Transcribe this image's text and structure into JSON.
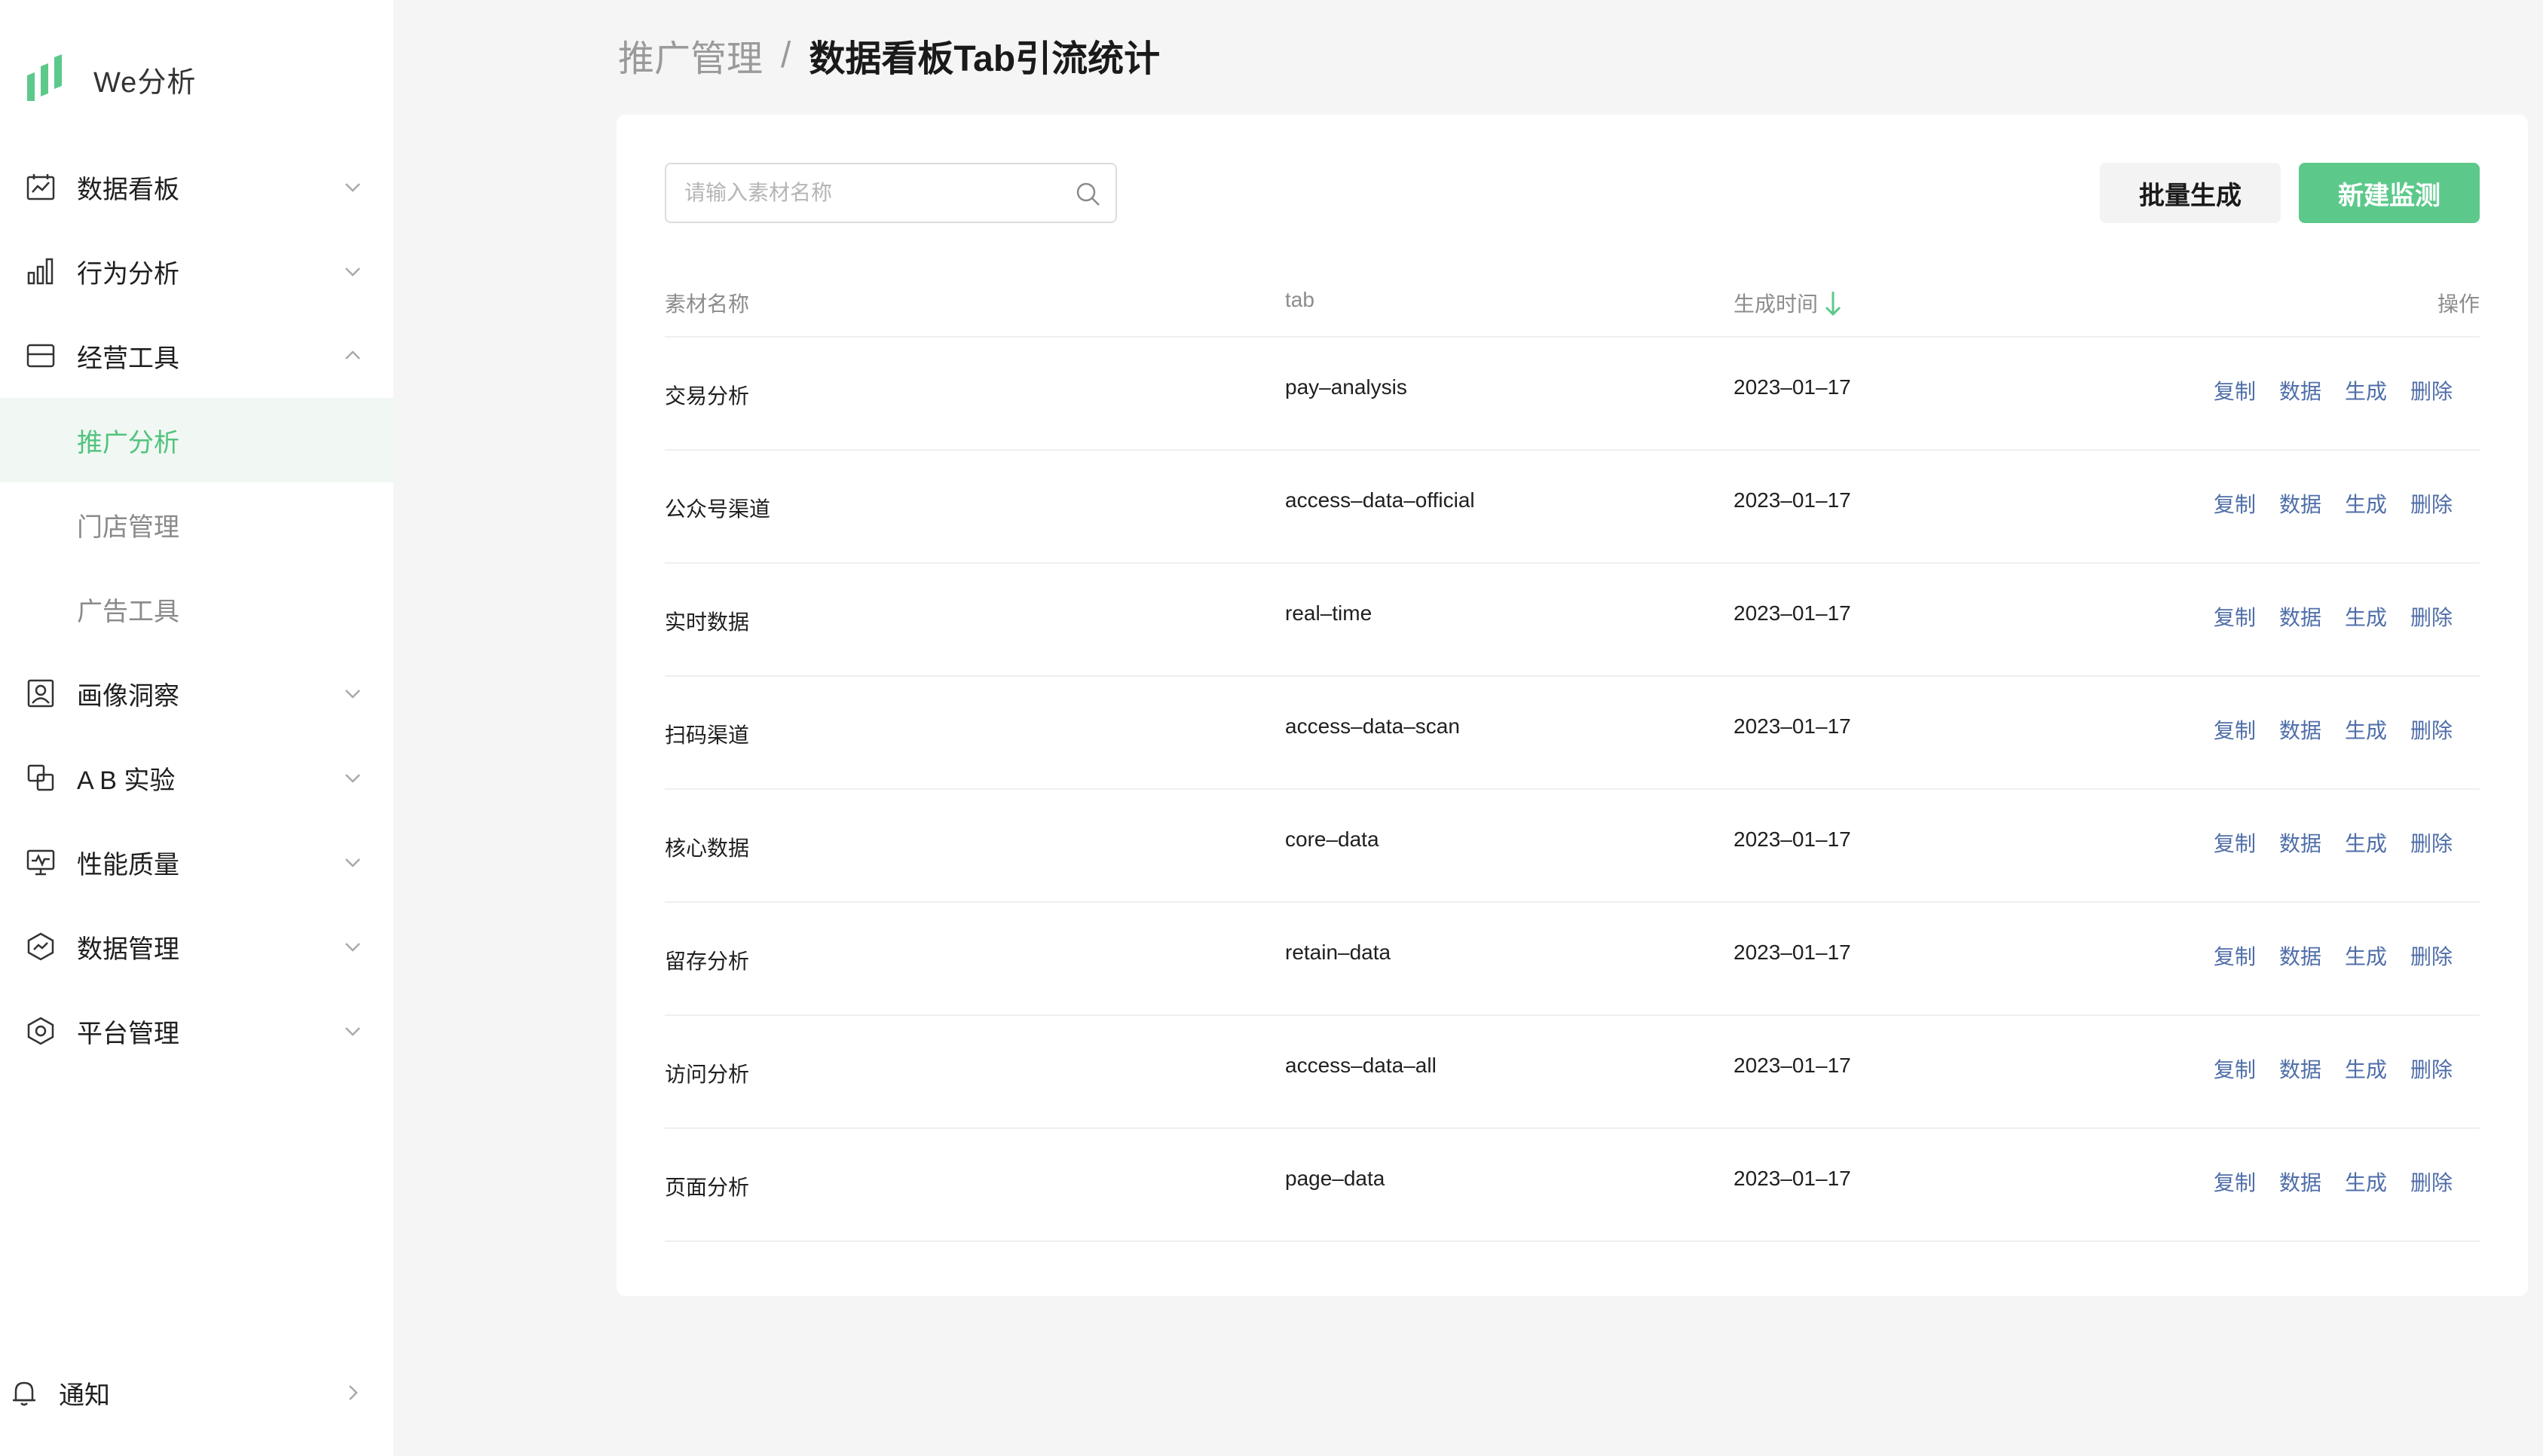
{
  "app": {
    "name": "We分析"
  },
  "sidebar": {
    "items": [
      {
        "label": "数据看板",
        "icon": "calendar-chart-icon",
        "expanded": false
      },
      {
        "label": "行为分析",
        "icon": "bar-chart-icon",
        "expanded": false
      },
      {
        "label": "经营工具",
        "icon": "store-icon",
        "expanded": true,
        "children": [
          {
            "label": "推广分析",
            "active": true
          },
          {
            "label": "门店管理",
            "active": false
          },
          {
            "label": "广告工具",
            "active": false
          }
        ]
      },
      {
        "label": "画像洞察",
        "icon": "portrait-icon",
        "expanded": false
      },
      {
        "label": "A B 实验",
        "icon": "ab-test-icon",
        "expanded": false
      },
      {
        "label": "性能质量",
        "icon": "monitor-icon",
        "expanded": false
      },
      {
        "label": "数据管理",
        "icon": "data-shield-icon",
        "expanded": false
      },
      {
        "label": "平台管理",
        "icon": "hexagon-settings-icon",
        "expanded": false
      }
    ],
    "notify": {
      "label": "通知",
      "icon": "bell-icon"
    }
  },
  "header": {
    "breadcrumb_parent": "推广管理",
    "breadcrumb_sep": "/",
    "breadcrumb_current": "数据看板Tab引流统计"
  },
  "toolbar": {
    "search_placeholder": "请输入素材名称",
    "batch_label": "批量生成",
    "new_label": "新建监测"
  },
  "table": {
    "columns": {
      "name": "素材名称",
      "tab": "tab",
      "time": "生成时间",
      "ops": "操作"
    },
    "sort": {
      "column": "time",
      "direction": "desc"
    },
    "op_labels": {
      "copy": "复制",
      "data": "数据",
      "generate": "生成",
      "delete": "删除"
    },
    "rows": [
      {
        "name": "交易分析",
        "tab": "pay–analysis",
        "time": "2023–01–17"
      },
      {
        "name": "公众号渠道",
        "tab": "access–data–official",
        "time": "2023–01–17"
      },
      {
        "name": "实时数据",
        "tab": "real–time",
        "time": "2023–01–17"
      },
      {
        "name": "扫码渠道",
        "tab": "access–data–scan",
        "time": "2023–01–17"
      },
      {
        "name": "核心数据",
        "tab": "core–data",
        "time": "2023–01–17"
      },
      {
        "name": "留存分析",
        "tab": "retain–data",
        "time": "2023–01–17"
      },
      {
        "name": "访问分析",
        "tab": "access–data–all",
        "time": "2023–01–17"
      },
      {
        "name": "页面分析",
        "tab": "page–data",
        "time": "2023–01–17"
      }
    ]
  },
  "colors": {
    "brand": "#5cc98b",
    "active_text": "#52c37e",
    "active_bg": "#f1f8f3",
    "link": "#4f6ea8",
    "page_bg": "#f5f5f5"
  }
}
